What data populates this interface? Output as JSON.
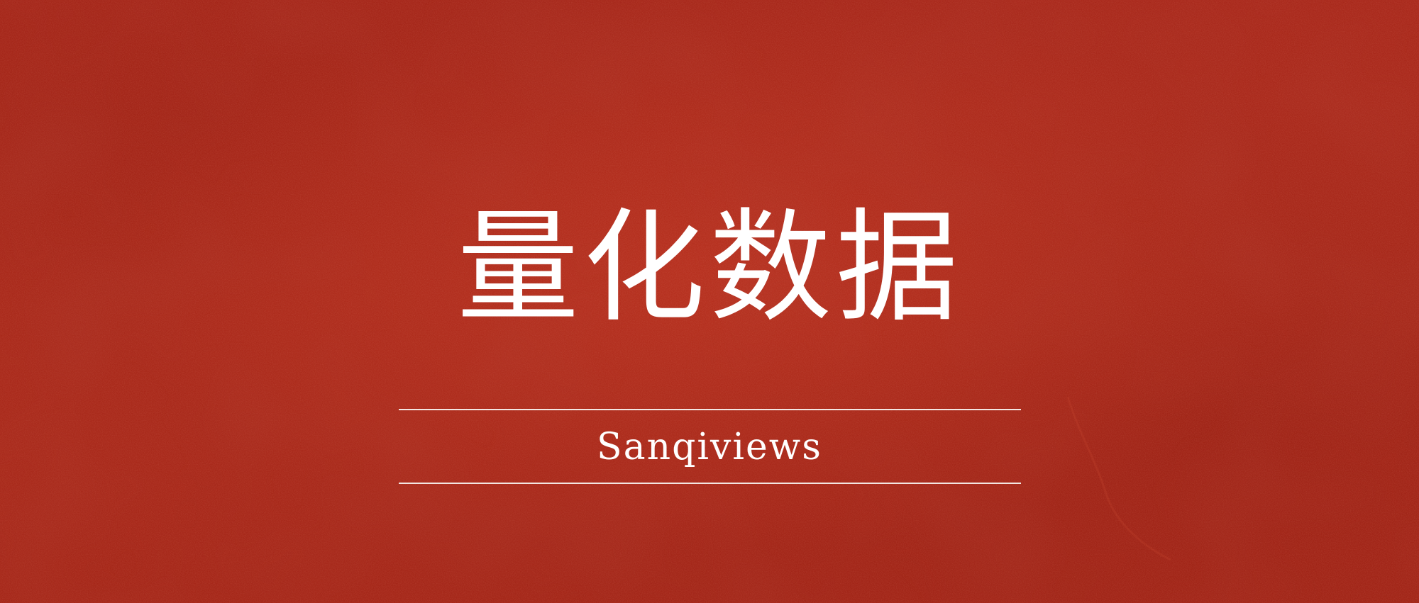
{
  "banner": {
    "title": "量化数据",
    "subtitle": "Sanqiviews"
  },
  "colors": {
    "background": "#a8281b",
    "text": "#ffffff",
    "rule": "#f3e6e2"
  }
}
